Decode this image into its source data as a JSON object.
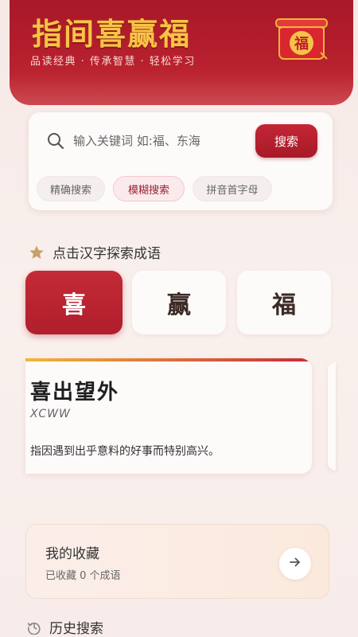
{
  "header": {
    "title": "指间喜赢福",
    "subtitle": "品读经典 · 传承智慧 · 轻松学习",
    "badge_char": "福"
  },
  "search": {
    "placeholder": "输入关键词 如:福、东海",
    "value": "",
    "button_label": "搜索",
    "modes": [
      {
        "label": "精确搜索",
        "active": false
      },
      {
        "label": "模糊搜索",
        "active": true
      },
      {
        "label": "拼音首字母",
        "active": false
      }
    ]
  },
  "explore": {
    "label": "点击汉字探索成语",
    "chars": [
      {
        "char": "喜",
        "active": true
      },
      {
        "char": "赢",
        "active": false
      },
      {
        "char": "福",
        "active": false
      }
    ]
  },
  "idiom": {
    "word": "喜出望外",
    "abbr": "XCWW",
    "definition": "指因遇到出乎意料的好事而特别高兴。"
  },
  "favorites": {
    "title": "我的收藏",
    "count_text": "已收藏 0 个成语"
  },
  "history": {
    "label": "历史搜索"
  },
  "colors": {
    "primary": "#b01e2c",
    "gold": "#f7c445",
    "background": "#f7ece9"
  }
}
